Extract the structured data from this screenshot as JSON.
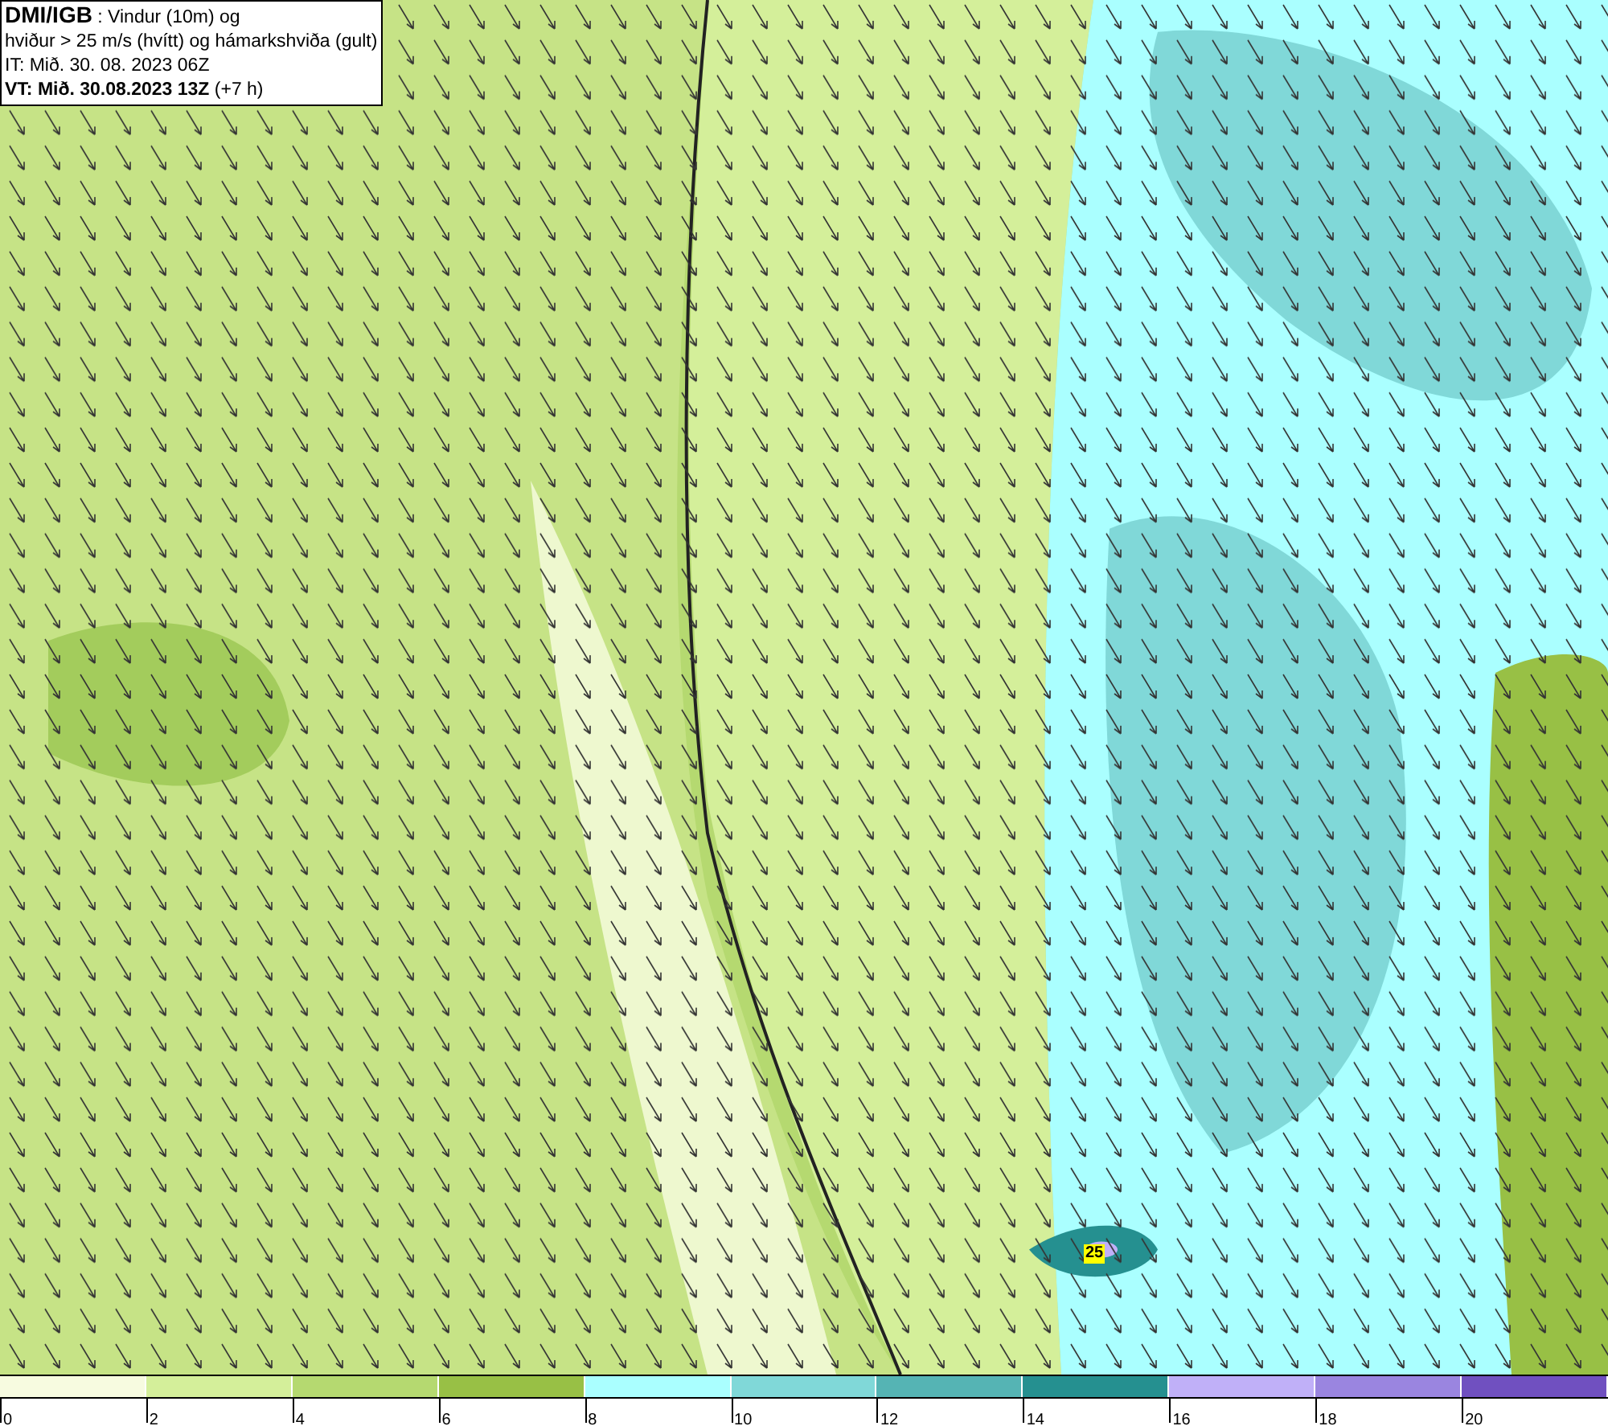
{
  "info_box": {
    "source": "DMI/IGB",
    "title_rest": " : Vindur (10m) og",
    "line_2": "hviður > 25 m/s (hvítt) og hámarkshviða (gult)",
    "initial_time": "IT: Mið. 30. 08. 2023 06Z",
    "valid_time_bold": "VT: Mið. 30.08.2023 13Z",
    "valid_offset": " (+7 h)"
  },
  "map": {
    "gust_label": "25"
  },
  "legend": [
    {
      "color": "#f7fbe0",
      "label": "0"
    },
    {
      "color": "#d4ef9a",
      "label": "2"
    },
    {
      "color": "#b5d970",
      "label": "4"
    },
    {
      "color": "#98c045",
      "label": "6"
    },
    {
      "color": "#aaffff",
      "label": "8"
    },
    {
      "color": "#80d8d8",
      "label": "10"
    },
    {
      "color": "#55b4b4",
      "label": "12"
    },
    {
      "color": "#259090",
      "label": "14"
    },
    {
      "color": "#c0b0f8",
      "label": "16"
    },
    {
      "color": "#9a85e0",
      "label": "18"
    },
    {
      "color": "#7050c0",
      "label": "20"
    }
  ]
}
